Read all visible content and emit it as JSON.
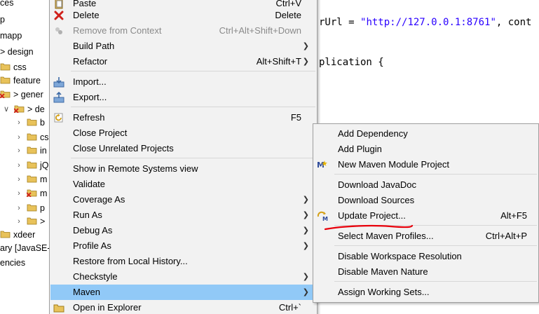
{
  "explorer": {
    "rows": [
      {
        "label": "ces",
        "chev": "",
        "icon": ""
      },
      {
        "label": "p",
        "chev": "",
        "icon": ""
      },
      {
        "label": "mapp",
        "chev": "",
        "icon": ""
      },
      {
        "label": "> design",
        "chev": "",
        "icon": ""
      },
      {
        "label": "css",
        "chev": "",
        "icon": "folder"
      },
      {
        "label": "feature",
        "chev": "",
        "icon": "folder"
      },
      {
        "label": "> gener",
        "chev": "",
        "icon": "folder-error"
      },
      {
        "label": "> de",
        "chev": "v",
        "icon": "folder-error"
      },
      {
        "label": "b",
        "chev": ">",
        "icon": "folder"
      },
      {
        "label": "cs",
        "chev": ">",
        "icon": "folder"
      },
      {
        "label": "in",
        "chev": ">",
        "icon": "folder"
      },
      {
        "label": "jQ",
        "chev": ">",
        "icon": "folder"
      },
      {
        "label": "m",
        "chev": ">",
        "icon": "folder"
      },
      {
        "label": "m",
        "chev": ">",
        "icon": "folder-error"
      },
      {
        "label": "p",
        "chev": ">",
        "icon": "folder"
      },
      {
        "label": ">",
        "chev": ">",
        "icon": "folder"
      },
      {
        "label": "xdeer",
        "chev": "",
        "icon": "folder"
      },
      {
        "label": "ary [JavaSE-",
        "chev": "",
        "icon": ""
      },
      {
        "label": "encies",
        "chev": "",
        "icon": ""
      }
    ]
  },
  "editor": {
    "line1_pre": "rUrl = ",
    "line1_str": "\"http://127.0.0.1:8761\"",
    "line1_post": ", cont",
    "line2": "plication {"
  },
  "main_menu": {
    "paste": {
      "label": "Paste",
      "shortcut": "Ctrl+V"
    },
    "delete": {
      "label": "Delete",
      "shortcut": "Delete"
    },
    "remove_from_context": {
      "label": "Remove from Context",
      "shortcut": "Ctrl+Alt+Shift+Down"
    },
    "build_path": {
      "label": "Build Path"
    },
    "refactor": {
      "label": "Refactor",
      "shortcut": "Alt+Shift+T"
    },
    "import": {
      "label": "Import..."
    },
    "export": {
      "label": "Export..."
    },
    "refresh": {
      "label": "Refresh",
      "shortcut": "F5"
    },
    "close_project": {
      "label": "Close Project"
    },
    "close_unrelated": {
      "label": "Close Unrelated Projects"
    },
    "show_remote": {
      "label": "Show in Remote Systems view"
    },
    "validate": {
      "label": "Validate"
    },
    "coverage_as": {
      "label": "Coverage As"
    },
    "run_as": {
      "label": "Run As"
    },
    "debug_as": {
      "label": "Debug As"
    },
    "profile_as": {
      "label": "Profile As"
    },
    "restore_history": {
      "label": "Restore from Local History..."
    },
    "checkstyle": {
      "label": "Checkstyle"
    },
    "maven": {
      "label": "Maven"
    },
    "open_explorer": {
      "label": "Open in Explorer",
      "shortcut": "Ctrl+`"
    }
  },
  "maven_menu": {
    "add_dependency": {
      "label": "Add Dependency"
    },
    "add_plugin": {
      "label": "Add Plugin"
    },
    "new_module": {
      "label": "New Maven Module Project"
    },
    "download_javadoc": {
      "label": "Download JavaDoc"
    },
    "download_sources": {
      "label": "Download Sources"
    },
    "update_project": {
      "label": "Update Project...",
      "shortcut": "Alt+F5"
    },
    "select_profiles": {
      "label": "Select Maven Profiles...",
      "shortcut": "Ctrl+Alt+P"
    },
    "disable_workspace": {
      "label": "Disable Workspace Resolution"
    },
    "disable_nature": {
      "label": "Disable Maven Nature"
    },
    "assign_working_sets": {
      "label": "Assign Working Sets..."
    }
  },
  "icons": {
    "paste": "clipboard-icon",
    "delete": "red-x-icon",
    "remove_from_context": "remove-context-icon",
    "import": "import-icon",
    "export": "export-icon",
    "refresh": "refresh-icon",
    "new_module": "maven-module-icon",
    "update_project": "maven-update-icon",
    "submenu_arrow": "chevron-right-icon"
  },
  "colors": {
    "menu_bg": "#f2f2f2",
    "hover_bg": "#91c9f7",
    "disabled_text": "#8a8a8a",
    "string_literal": "#2a00ff",
    "annotation_stroke": "#e8000b"
  }
}
